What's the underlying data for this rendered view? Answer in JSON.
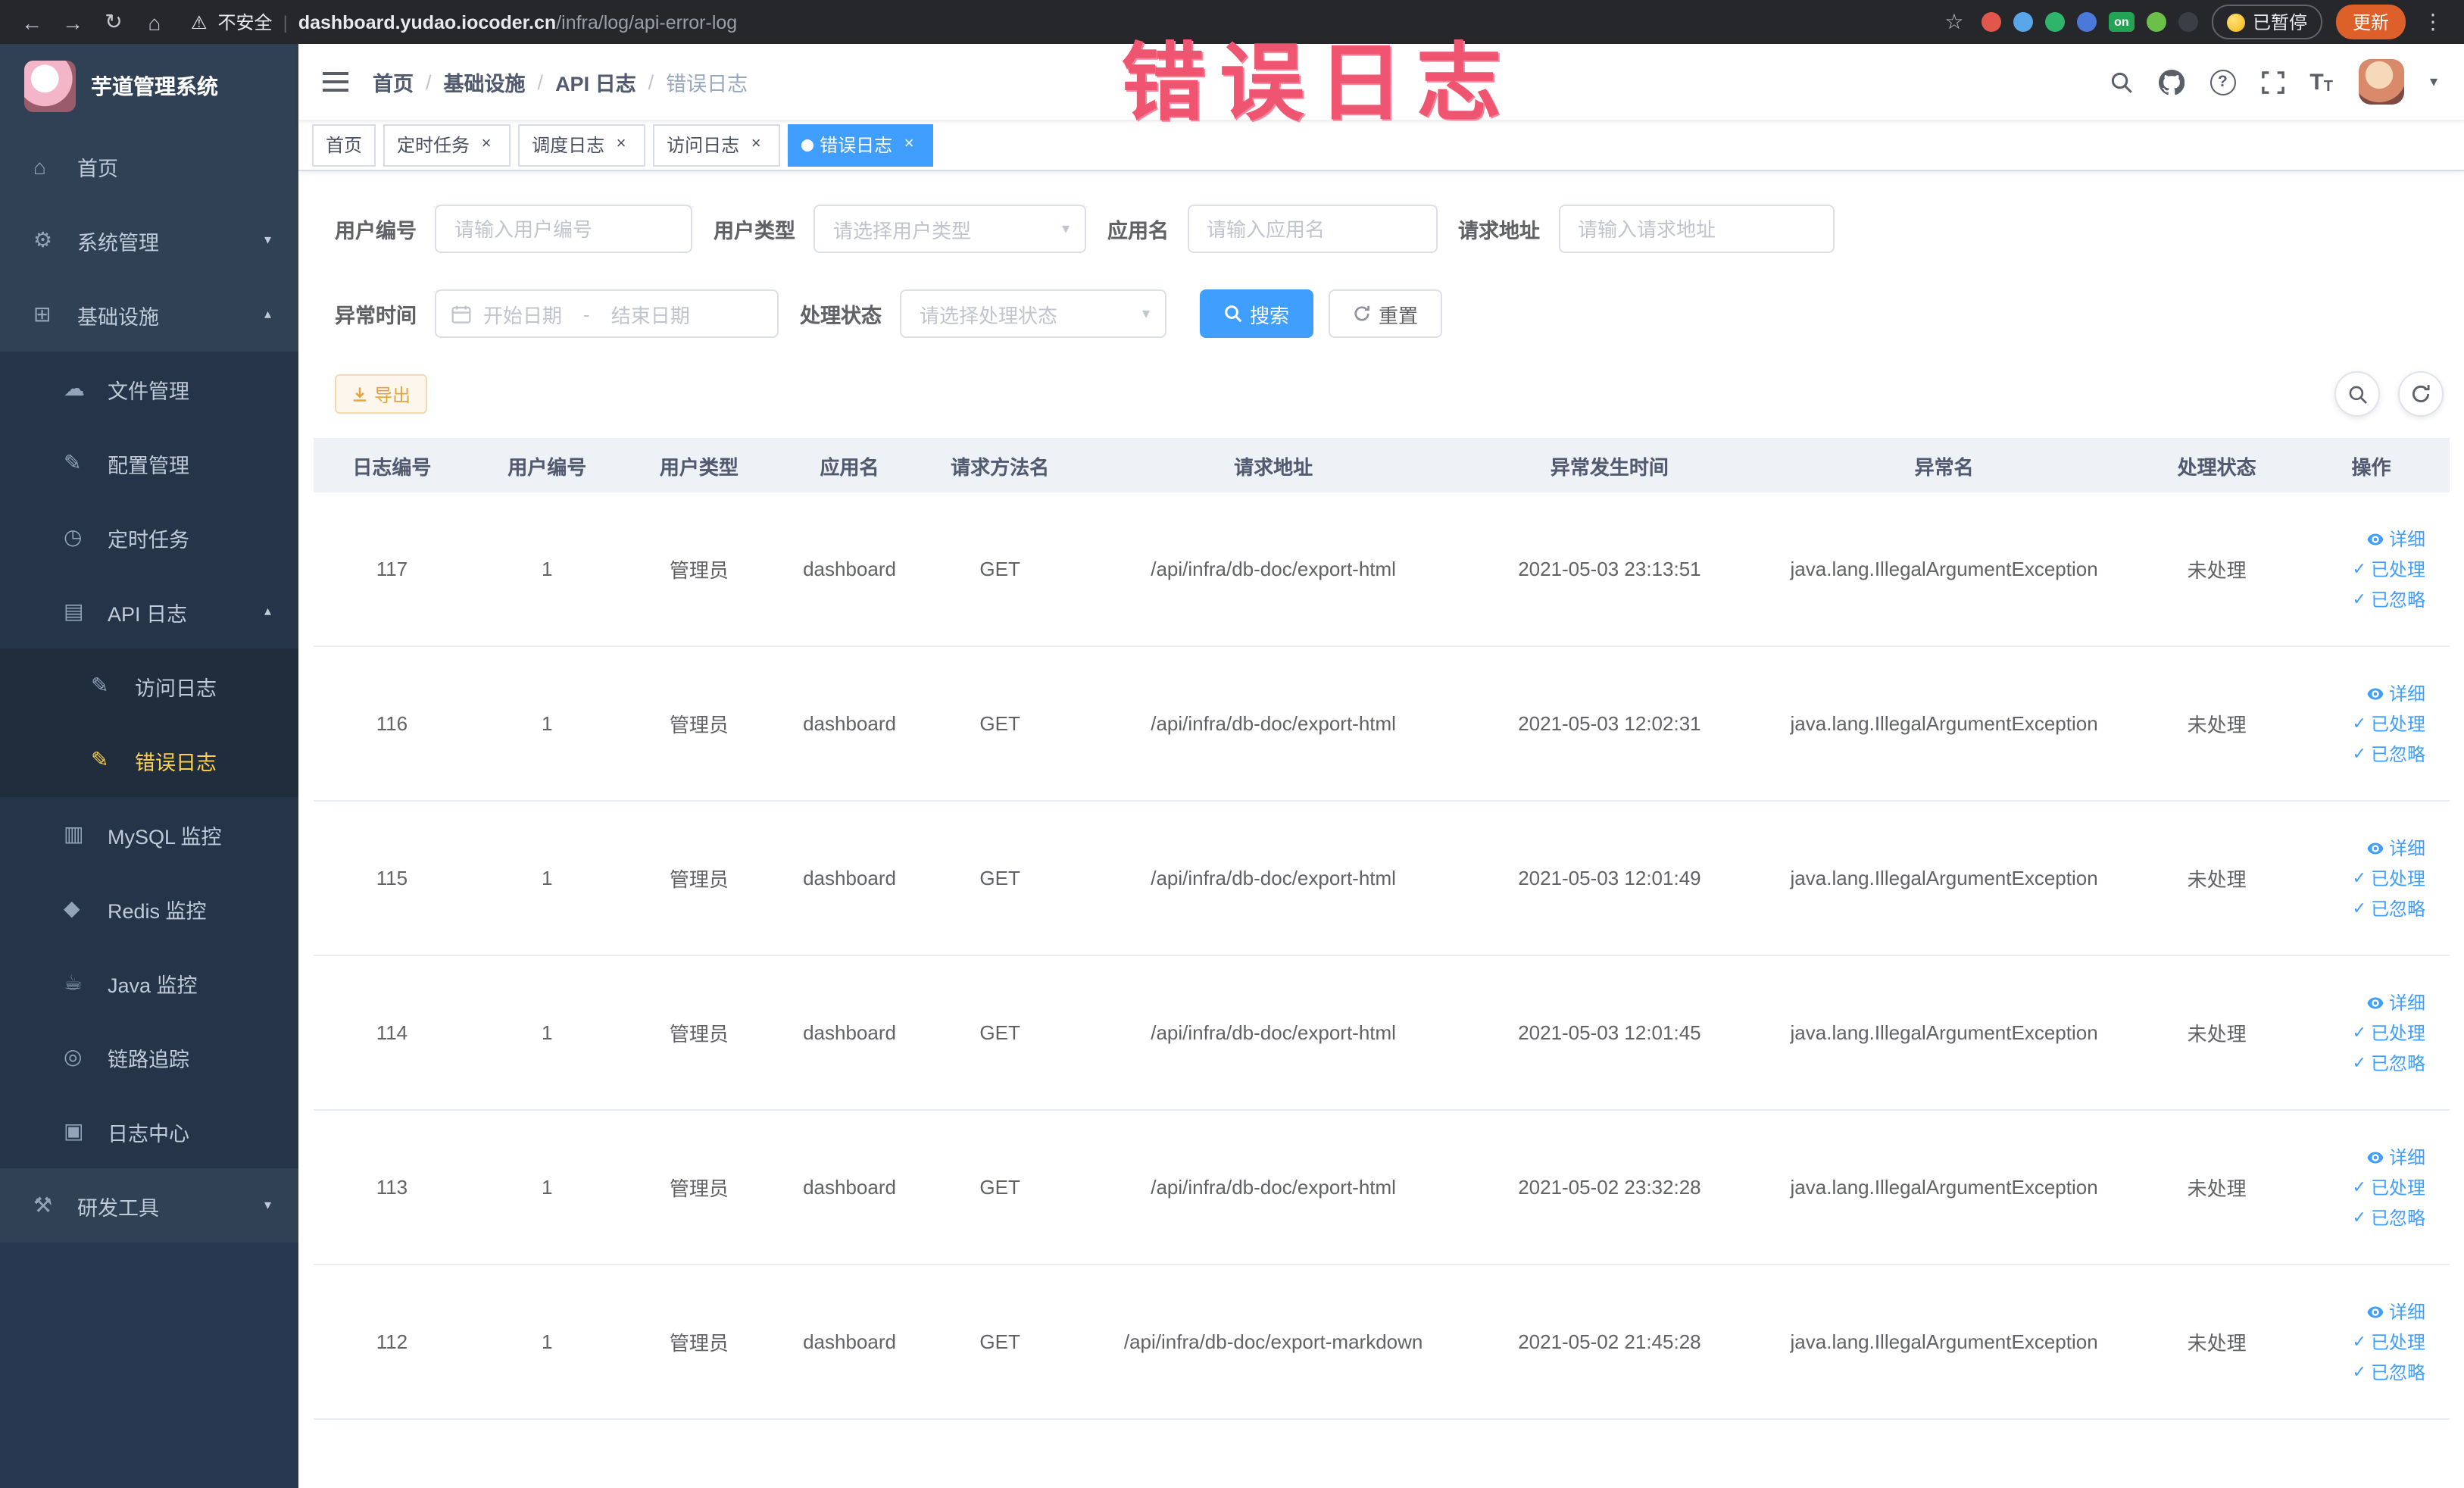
{
  "colors": {
    "accent": "#409eff",
    "sidebar_bg": "#304156",
    "sidebar_submenu_bg": "#253449",
    "sidebar_deep_submenu_bg": "#1f2d3d",
    "sidebar_active_text": "#ffd04b",
    "warning": "#e6a23c",
    "annotation": "#ef5571",
    "update_button": "#dd5f29"
  },
  "annotation": {
    "text": "错误日志"
  },
  "browser": {
    "security_warning": "不安全",
    "url_domain": "dashboard.yudao.iocoder.cn",
    "url_path": "/infra/log/api-error-log",
    "paused_badge": "已暂停",
    "update_button": "更新",
    "extensions": [
      {
        "name": "extension-icon",
        "color": "#e2574c"
      },
      {
        "name": "extension-icon",
        "color": "#58a6e8"
      },
      {
        "name": "extension-icon",
        "color": "#2fb56b"
      },
      {
        "name": "extension-icon",
        "color": "#4a79d9"
      },
      {
        "name": "extension-icon",
        "color": "#23a455",
        "label": "on"
      },
      {
        "name": "extension-icon",
        "color": "#6cc04a"
      },
      {
        "name": "extension-icon",
        "color": "#3a3f46"
      }
    ]
  },
  "icons": {
    "back-icon": "←",
    "forward-icon": "→",
    "reload-icon": "↻",
    "home-icon": "⌂",
    "warning-icon": "⚠",
    "star-icon": "☆",
    "kebab-icon": "⋮",
    "caret-down": "▾",
    "chevron-down": "▾",
    "chevron-up": "▴",
    "check-icon": "✓",
    "menu-home-icon": "⌂",
    "menu-system-icon": "⚙",
    "menu-infra-icon": "⊞",
    "menu-file-icon": "☁",
    "menu-config-icon": "✎",
    "menu-job-icon": "◷",
    "menu-apilog-icon": "▤",
    "menu-accesslog-icon": "✎",
    "menu-errorlog-icon": "✎",
    "menu-mysql-icon": "▥",
    "menu-redis-icon": "◆",
    "menu-java-icon": "☕",
    "menu-trace-icon": "◎",
    "menu-logcenter-icon": "▣",
    "menu-devtools-icon": "⚒"
  },
  "sidebar": {
    "logo_title": "芋道管理系统",
    "items": [
      {
        "label": "首页",
        "icon": "menu-home-icon",
        "level": 1
      },
      {
        "label": "系统管理",
        "icon": "menu-system-icon",
        "level": 1,
        "chevron": "down"
      },
      {
        "label": "基础设施",
        "icon": "menu-infra-icon",
        "level": 1,
        "chevron": "up"
      },
      {
        "label": "文件管理",
        "icon": "menu-file-icon",
        "level": 2
      },
      {
        "label": "配置管理",
        "icon": "menu-config-icon",
        "level": 2
      },
      {
        "label": "定时任务",
        "icon": "menu-job-icon",
        "level": 2
      },
      {
        "label": "API 日志",
        "icon": "menu-apilog-icon",
        "level": 2,
        "chevron": "up"
      },
      {
        "label": "访问日志",
        "icon": "menu-accesslog-icon",
        "level": 3
      },
      {
        "label": "错误日志",
        "icon": "menu-errorlog-icon",
        "level": 3,
        "active": true
      },
      {
        "label": "MySQL 监控",
        "icon": "menu-mysql-icon",
        "level": 2
      },
      {
        "label": "Redis 监控",
        "icon": "menu-redis-icon",
        "level": 2
      },
      {
        "label": "Java 监控",
        "icon": "menu-java-icon",
        "level": 2
      },
      {
        "label": "链路追踪",
        "icon": "menu-trace-icon",
        "level": 2
      },
      {
        "label": "日志中心",
        "icon": "menu-logcenter-icon",
        "level": 2
      },
      {
        "label": "研发工具",
        "icon": "menu-devtools-icon",
        "level": 1,
        "chevron": "down"
      }
    ]
  },
  "header": {
    "breadcrumb": [
      "首页",
      "基础设施",
      "API 日志",
      "错误日志"
    ]
  },
  "tabs": [
    {
      "label": "首页",
      "closable": false,
      "active": false
    },
    {
      "label": "定时任务",
      "closable": true,
      "active": false
    },
    {
      "label": "调度日志",
      "closable": true,
      "active": false
    },
    {
      "label": "访问日志",
      "closable": true,
      "active": false
    },
    {
      "label": "错误日志",
      "closable": true,
      "active": true
    }
  ],
  "filters": {
    "user_id": {
      "label": "用户编号",
      "placeholder": "请输入用户编号"
    },
    "user_type": {
      "label": "用户类型",
      "placeholder": "请选择用户类型"
    },
    "app_name": {
      "label": "应用名",
      "placeholder": "请输入应用名"
    },
    "request_url": {
      "label": "请求地址",
      "placeholder": "请输入请求地址"
    },
    "exception_time": {
      "label": "异常时间",
      "start_placeholder": "开始日期",
      "separator": "-",
      "end_placeholder": "结束日期"
    },
    "process_status": {
      "label": "处理状态",
      "placeholder": "请选择处理状态"
    },
    "search_button": "搜索",
    "reset_button": "重置"
  },
  "toolbar": {
    "export_button": "导出"
  },
  "table": {
    "columns": [
      "日志编号",
      "用户编号",
      "用户类型",
      "应用名",
      "请求方法名",
      "请求地址",
      "异常发生时间",
      "异常名",
      "处理状态",
      "操作"
    ],
    "actions": [
      {
        "label": "详细",
        "name": "detail-action",
        "icon": "eye-icon"
      },
      {
        "label": "已处理",
        "name": "mark-processed-action",
        "icon": "check-icon"
      },
      {
        "label": "已忽略",
        "name": "mark-ignored-action",
        "icon": "check-icon"
      }
    ],
    "rows": [
      {
        "id": "117",
        "user_id": "1",
        "user_type": "管理员",
        "app": "dashboard",
        "method": "GET",
        "url": "/api/infra/db-doc/export-html",
        "time": "2021-05-03 23:13:51",
        "exception": "java.lang.IllegalArgumentException",
        "status": "未处理"
      },
      {
        "id": "116",
        "user_id": "1",
        "user_type": "管理员",
        "app": "dashboard",
        "method": "GET",
        "url": "/api/infra/db-doc/export-html",
        "time": "2021-05-03 12:02:31",
        "exception": "java.lang.IllegalArgumentException",
        "status": "未处理"
      },
      {
        "id": "115",
        "user_id": "1",
        "user_type": "管理员",
        "app": "dashboard",
        "method": "GET",
        "url": "/api/infra/db-doc/export-html",
        "time": "2021-05-03 12:01:49",
        "exception": "java.lang.IllegalArgumentException",
        "status": "未处理"
      },
      {
        "id": "114",
        "user_id": "1",
        "user_type": "管理员",
        "app": "dashboard",
        "method": "GET",
        "url": "/api/infra/db-doc/export-html",
        "time": "2021-05-03 12:01:45",
        "exception": "java.lang.IllegalArgumentException",
        "status": "未处理"
      },
      {
        "id": "113",
        "user_id": "1",
        "user_type": "管理员",
        "app": "dashboard",
        "method": "GET",
        "url": "/api/infra/db-doc/export-html",
        "time": "2021-05-02 23:32:28",
        "exception": "java.lang.IllegalArgumentException",
        "status": "未处理"
      },
      {
        "id": "112",
        "user_id": "1",
        "user_type": "管理员",
        "app": "dashboard",
        "method": "GET",
        "url": "/api/infra/db-doc/export-markdown",
        "time": "2021-05-02 21:45:28",
        "exception": "java.lang.IllegalArgumentException",
        "status": "未处理"
      }
    ]
  }
}
